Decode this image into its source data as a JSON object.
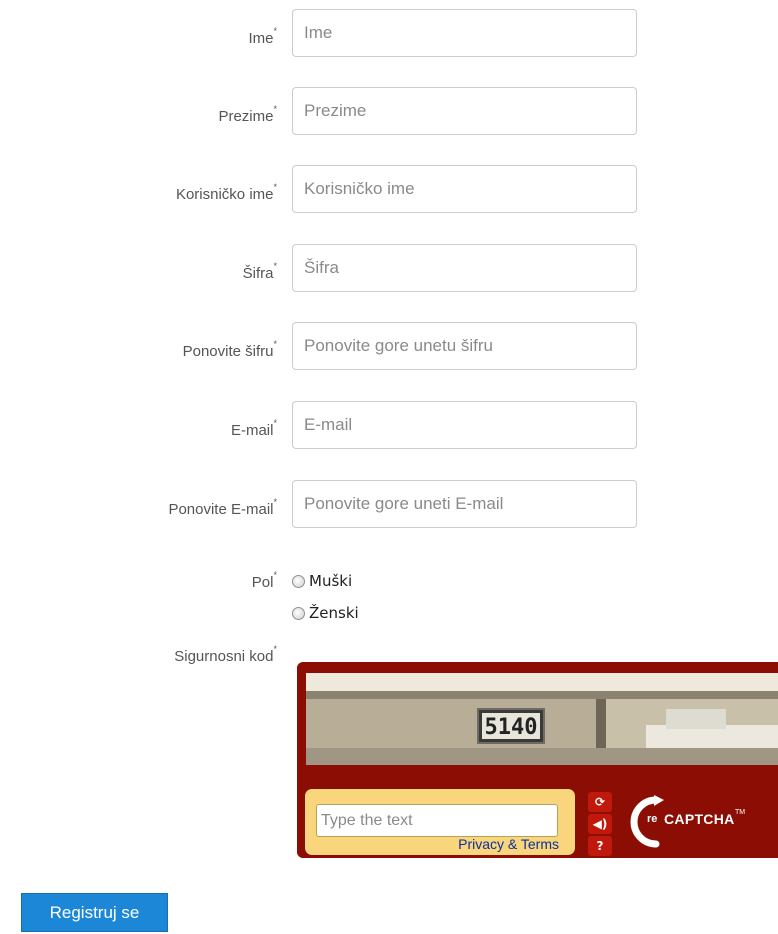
{
  "fields": [
    {
      "label": "Ime",
      "required_mark": "*",
      "placeholder": "Ime"
    },
    {
      "label": "Prezime",
      "required_mark": "*",
      "placeholder": "Prezime"
    },
    {
      "label": "Korisničko ime",
      "required_mark": "*",
      "placeholder": "Korisničko ime"
    },
    {
      "label": "Šifra",
      "required_mark": "*",
      "placeholder": "Šifra"
    },
    {
      "label": "Ponovite šifru",
      "required_mark": "*",
      "placeholder": "Ponovite gore unetu šifru"
    },
    {
      "label": "E-mail",
      "required_mark": "*",
      "placeholder": "E-mail"
    },
    {
      "label": "Ponovite E-mail",
      "required_mark": "*",
      "placeholder": "Ponovite gore uneti E-mail"
    }
  ],
  "gender": {
    "label": "Pol",
    "required_mark": "*",
    "options": [
      "Muški",
      "Ženski"
    ]
  },
  "captcha": {
    "label": "Sigurnosni kod",
    "required_mark": "*",
    "image_text": "5140",
    "input_placeholder": "Type the text",
    "privacy_link": "Privacy & Terms",
    "logo_text": "CAPTCHA",
    "logo_prefix": "re",
    "logo_tm": "TM",
    "icons": [
      "refresh-icon",
      "audio-icon",
      "help-icon"
    ]
  },
  "submit_label": "Registruj se"
}
